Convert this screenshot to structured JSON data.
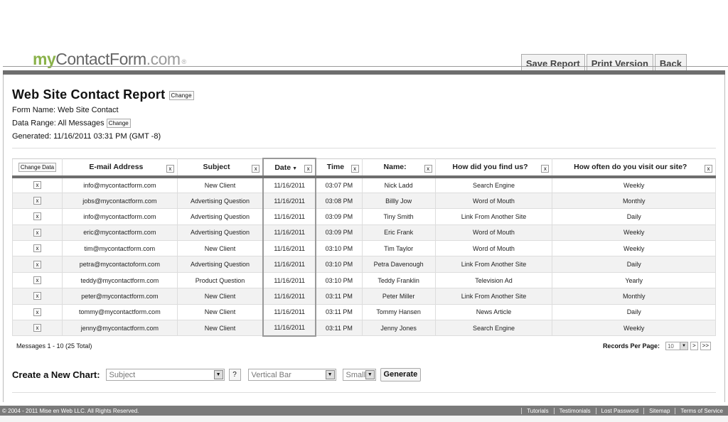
{
  "logo": {
    "my": "my",
    "contact": "ContactForm",
    "dotcom": ".com",
    "reg": "®"
  },
  "top_buttons": {
    "save": "Save Report",
    "print": "Print Version",
    "back": "Back"
  },
  "report": {
    "title": "Web Site Contact Report",
    "change": "Change",
    "form_name": "Form Name: Web Site Contact",
    "data_range": "Data Range: All Messages",
    "generated": "Generated: 11/16/2011 03:31 PM (GMT -8)"
  },
  "table": {
    "change_data": "Change Data",
    "remove": "x",
    "sort_caret": "▼",
    "headers": [
      "E-mail Address",
      "Subject",
      "Date",
      "Time",
      "Name:",
      "How did you find us?",
      "How often do you visit our site?"
    ],
    "rows": [
      [
        "info@mycontactform.com",
        "New Client",
        "11/16/2011",
        "03:07 PM",
        "Nick Ladd",
        "Search Engine",
        "Weekly"
      ],
      [
        "jobs@mycontactform.com",
        "Advertising Question",
        "11/16/2011",
        "03:08 PM",
        "Billly Jow",
        "Word of Mouth",
        "Monthly"
      ],
      [
        "info@mycontactform.com",
        "Advertising Question",
        "11/16/2011",
        "03:09 PM",
        "Tiny Smith",
        "Link From Another Site",
        "Daily"
      ],
      [
        "eric@mycontactform.com",
        "Advertising Question",
        "11/16/2011",
        "03:09 PM",
        "Eric Frank",
        "Word of Mouth",
        "Weekly"
      ],
      [
        "tim@mycontactform.com",
        "New Client",
        "11/16/2011",
        "03:10 PM",
        "Tim Taylor",
        "Word of Mouth",
        "Weekly"
      ],
      [
        "petra@mycontactoform.com",
        "Advertising Question",
        "11/16/2011",
        "03:10 PM",
        "Petra Davenough",
        "Link From Another Site",
        "Daily"
      ],
      [
        "teddy@mycontactform.com",
        "Product Question",
        "11/16/2011",
        "03:10 PM",
        "Teddy Franklin",
        "Television Ad",
        "Yearly"
      ],
      [
        "peter@mycontactform.com",
        "New Client",
        "11/16/2011",
        "03:11 PM",
        "Peter Miller",
        "Link From Another Site",
        "Monthly"
      ],
      [
        "tommy@mycontactform.com",
        "New Client",
        "11/16/2011",
        "03:11 PM",
        "Tommy Hansen",
        "News Article",
        "Daily"
      ],
      [
        "jenny@mycontactform.com",
        "New Client",
        "11/16/2011",
        "03:11 PM",
        "Jenny Jones",
        "Search Engine",
        "Weekly"
      ]
    ]
  },
  "pagination": {
    "messages": "Messages 1 - 10 (25 Total)",
    "records_label": "Records Per Page:",
    "records_value": "10",
    "next": ">",
    "last": ">>"
  },
  "chart": {
    "label": "Create a New Chart:",
    "field": "Subject",
    "help": "?",
    "type": "Vertical Bar",
    "size": "Small",
    "generate": "Generate"
  },
  "footer": {
    "copyright": "© 2004 - 2011 Mise en Web LLC. All Rights Reserved.",
    "links": [
      "Tutorials",
      "Testimonials",
      "Lost Password",
      "Sitemap",
      "Terms of Service"
    ]
  }
}
